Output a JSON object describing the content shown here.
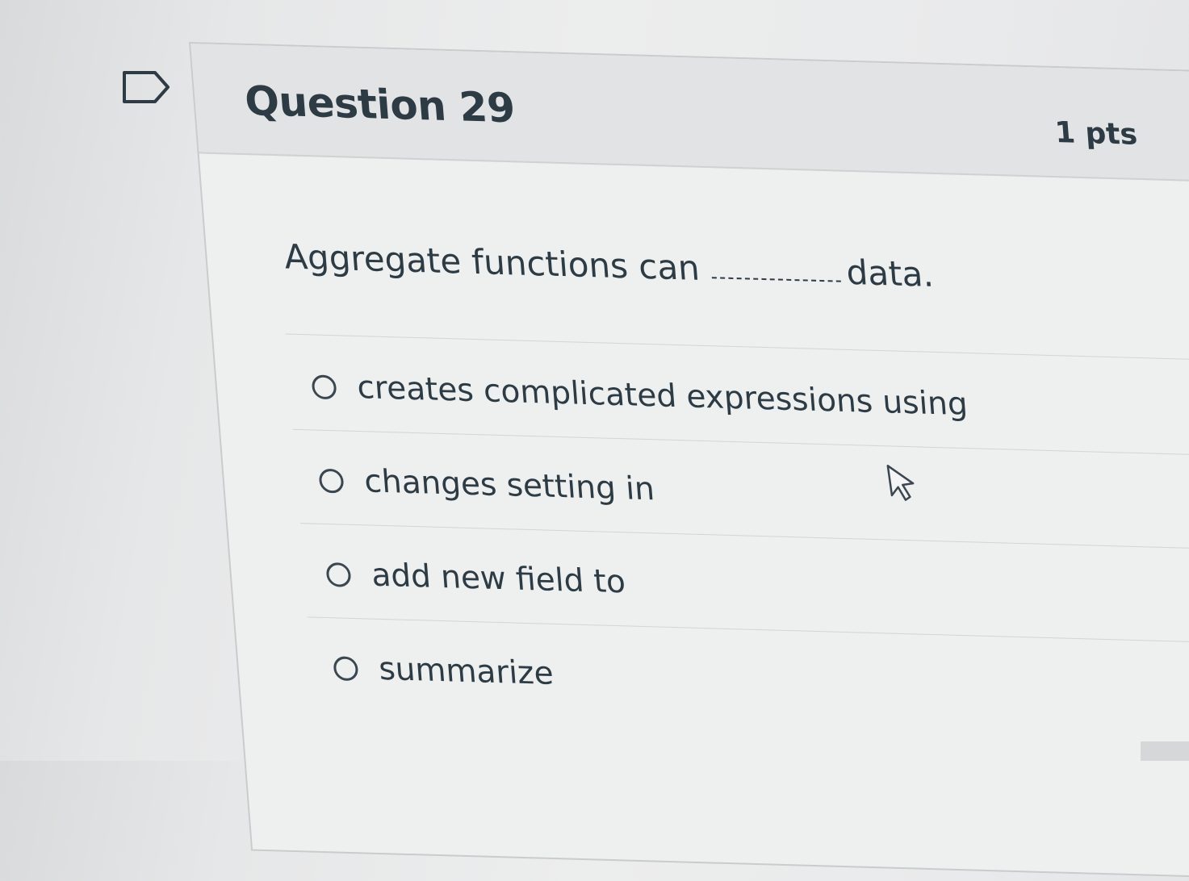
{
  "flag": {
    "icon": "flag-icon"
  },
  "question": {
    "title": "Question 29",
    "points": "1 pts",
    "text_before": "Aggregate functions  can",
    "text_after": "data.",
    "answers": [
      {
        "label": "creates complicated expressions using"
      },
      {
        "label": "changes setting in"
      },
      {
        "label": "add new field to"
      },
      {
        "label": "summarize"
      }
    ]
  },
  "cursor": {
    "icon": "arrow-pointer-icon"
  }
}
